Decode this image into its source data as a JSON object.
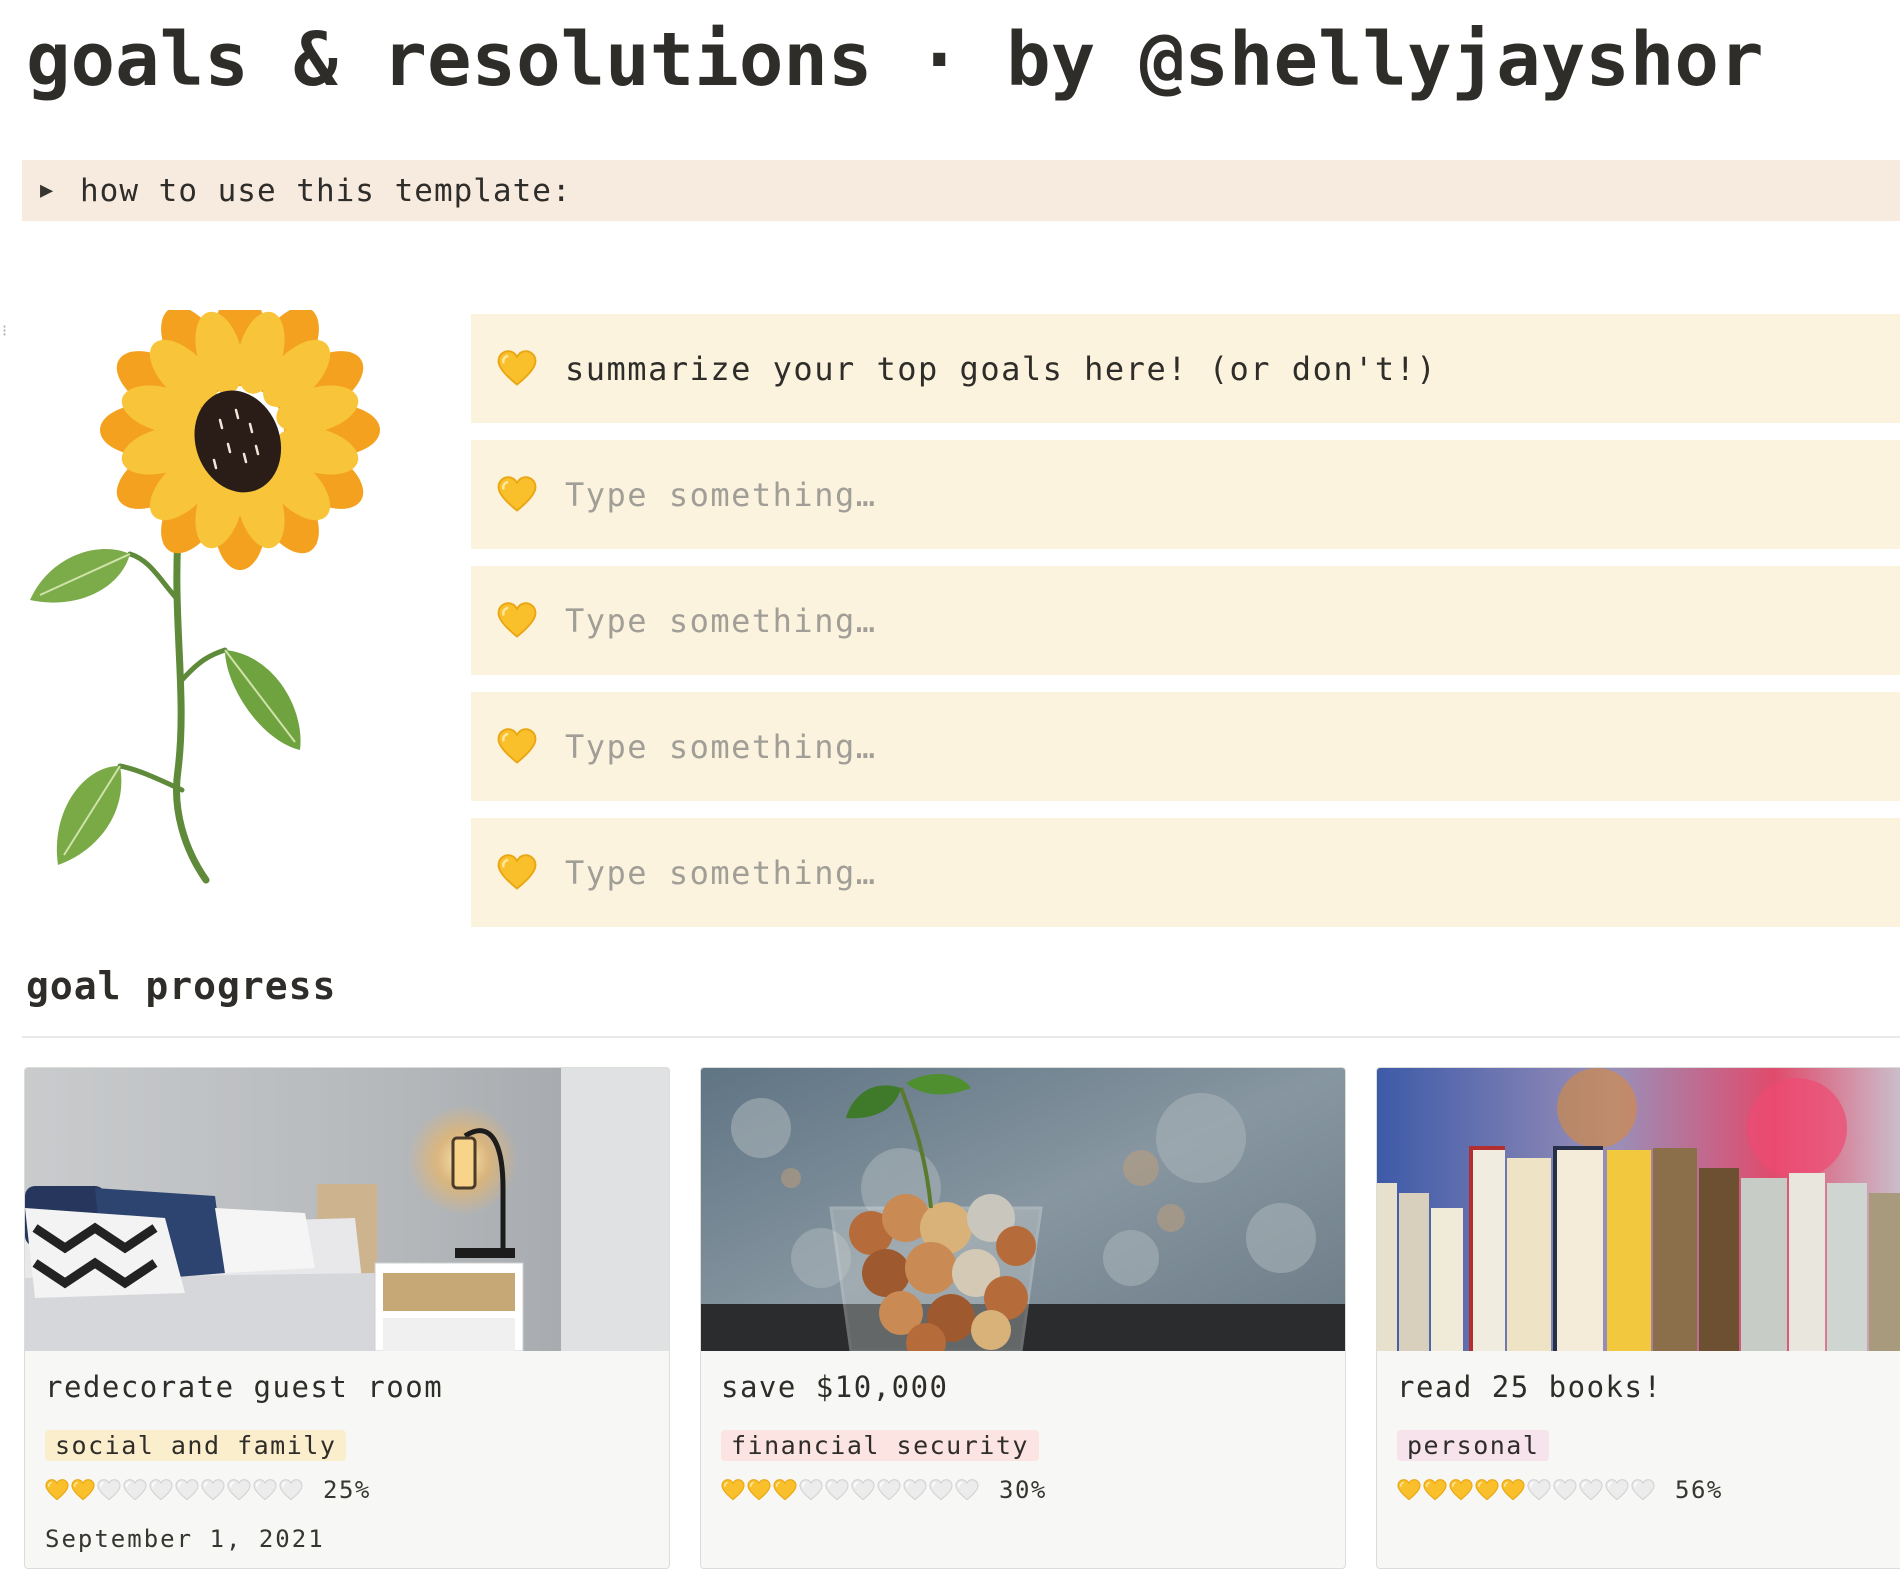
{
  "page": {
    "title": "goals & resolutions · by @shellyjayshor"
  },
  "toggle": {
    "label": "how to use this template:"
  },
  "callouts": [
    {
      "icon": "yellow-heart-icon",
      "text": "summarize your top goals here! (or don't!)"
    },
    {
      "icon": "yellow-heart-icon",
      "placeholder": "Type something…"
    },
    {
      "icon": "yellow-heart-icon",
      "placeholder": "Type something…"
    },
    {
      "icon": "yellow-heart-icon",
      "placeholder": "Type something…"
    },
    {
      "icon": "yellow-heart-icon",
      "placeholder": "Type something…"
    }
  ],
  "section": {
    "title": "goal progress"
  },
  "cards": [
    {
      "name": "redecorate guest room",
      "tag": "social and family",
      "tag_color": "#fbeecc",
      "progress_filled": 2,
      "progress_total": 10,
      "progress_text": "25%",
      "date": "September 1, 2021",
      "cover": "bedroom-photo"
    },
    {
      "name": "save $10,000",
      "tag": "financial security",
      "tag_color": "#fbe4e1",
      "progress_filled": 3,
      "progress_total": 10,
      "progress_text": "30%",
      "date": "",
      "cover": "coins-jar-photo"
    },
    {
      "name": "read 25 books!",
      "tag": "personal",
      "tag_color": "#f6e3ec",
      "progress_filled": 5,
      "progress_total": 10,
      "progress_text": "56%",
      "date": "",
      "cover": "books-photo"
    }
  ],
  "colors": {
    "toggle_bg": "#f7ebe0",
    "callout_bg": "#fbf3dd",
    "heart_yellow": "#f9c02c",
    "heart_grey": "#e3e3e3"
  }
}
